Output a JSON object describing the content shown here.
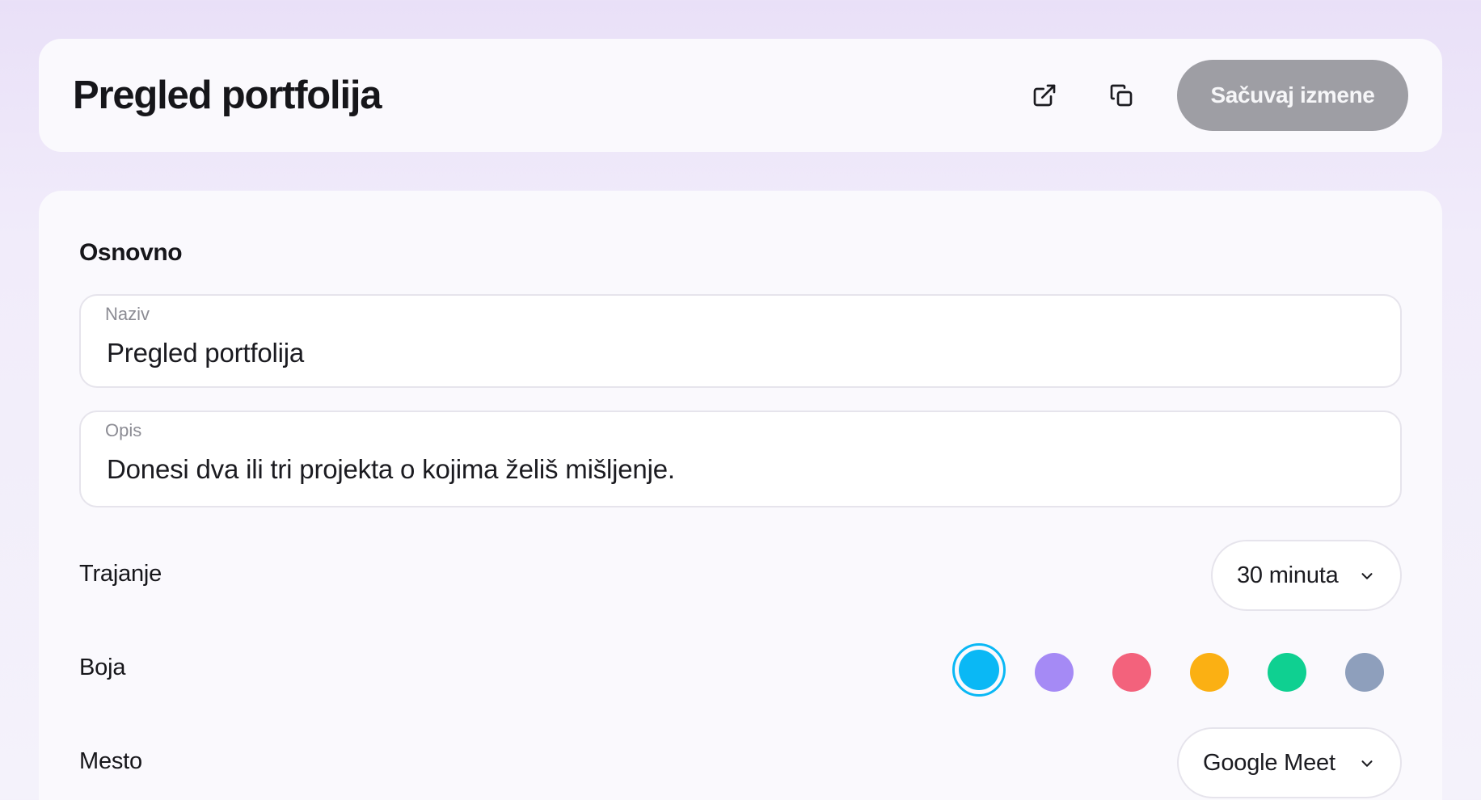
{
  "header": {
    "title": "Pregled portfolija",
    "save_label": "Sačuvaj izmene",
    "icons": {
      "open_external": "external-link-icon",
      "duplicate": "copy-icon"
    }
  },
  "basic": {
    "section_title": "Osnovno",
    "name": {
      "label": "Naziv",
      "value": "Pregled portfolija"
    },
    "description": {
      "label": "Opis",
      "value": "Donesi dva ili tri projekta o kojima želiš mišljenje."
    },
    "duration": {
      "label": "Trajanje",
      "selected": "30 minuta"
    },
    "color": {
      "label": "Boja",
      "options": [
        "#0ab8f5",
        "#a58af5",
        "#f3627c",
        "#fbb013",
        "#0fd091",
        "#8e9fbc"
      ],
      "selected_index": 0
    },
    "location": {
      "label": "Mesto",
      "selected": "Google Meet"
    }
  },
  "colors": {
    "save_button_bg": "#9e9ea4",
    "accent": "#0ab8f5"
  }
}
